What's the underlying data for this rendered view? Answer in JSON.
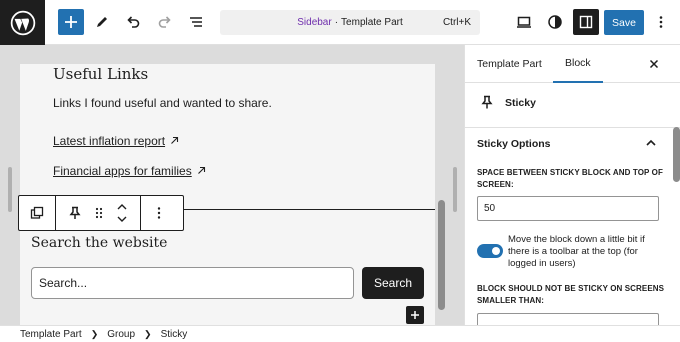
{
  "topbar": {
    "command_palette": {
      "entity": "Sidebar",
      "separator": "·",
      "type": "Template Part",
      "shortcut": "Ctrl+K"
    },
    "save_label": "Save",
    "accent_color": "#2271b1"
  },
  "canvas": {
    "heading": "Useful Links",
    "description": "Links I found useful and wanted to share.",
    "links": [
      {
        "label": "Latest inflation report",
        "icon": "external-arrow-icon"
      },
      {
        "label": "Financial apps for families",
        "icon": "external-arrow-icon"
      }
    ],
    "search_heading": "Search the website",
    "search_placeholder": "Search...",
    "search_button": "Search"
  },
  "sidebar": {
    "tabs": [
      "Template Part",
      "Block"
    ],
    "active_tab": "Block",
    "block_name": "Sticky",
    "panel_title": "Sticky Options",
    "space_label": "SPACE BETWEEN STICKY BLOCK AND TOP OF SCREEN:",
    "space_value": "50",
    "toggle_label": "Move the block down a little bit if there is a toolbar at the top (for logged in users)",
    "toggle_on": true,
    "min_width_label": "BLOCK SHOULD NOT BE STICKY ON SCREENS SMALLER THAN:"
  },
  "breadcrumb": [
    "Template Part",
    "Group",
    "Sticky"
  ]
}
